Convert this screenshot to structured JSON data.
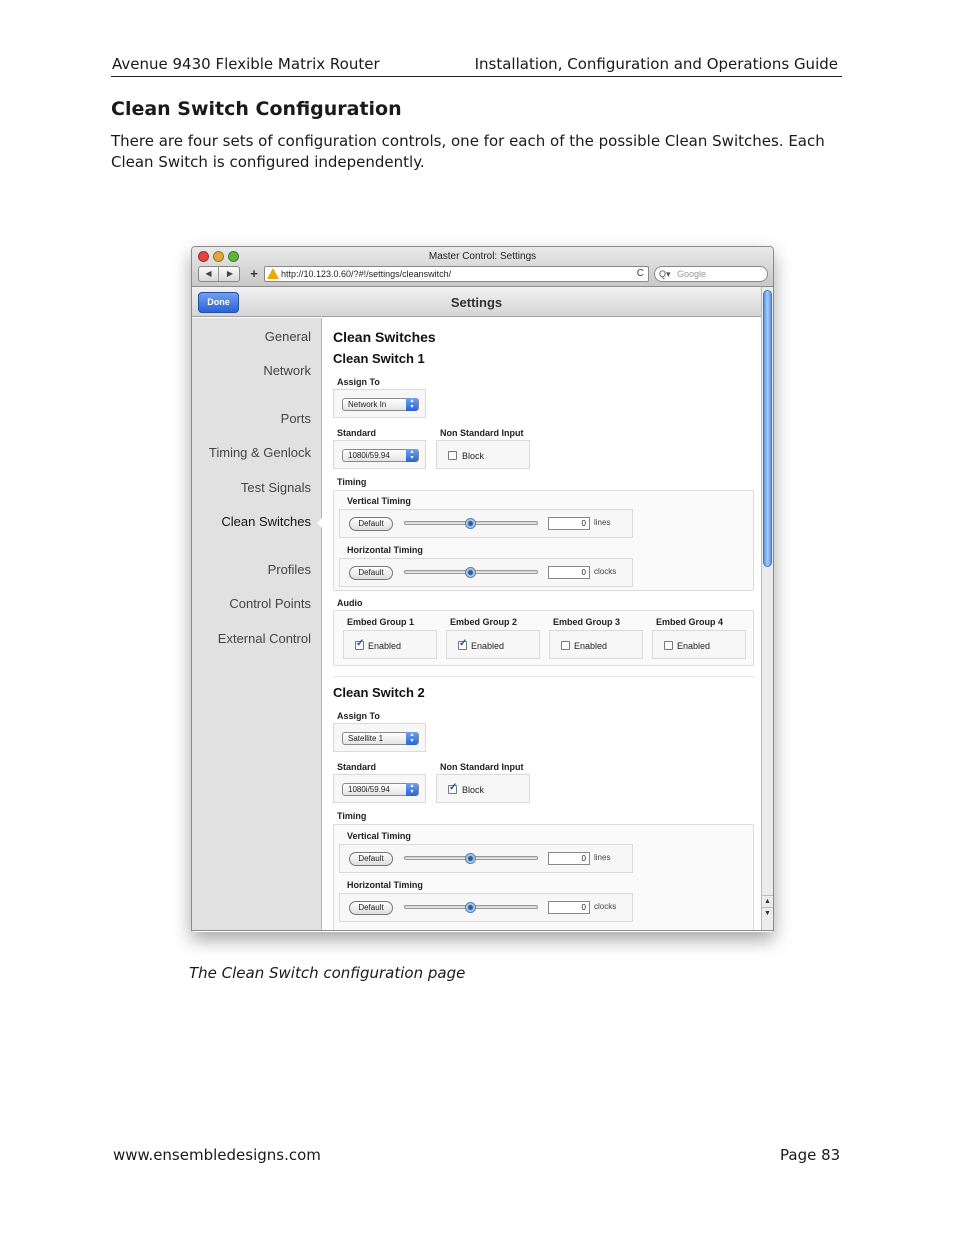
{
  "header": {
    "product": "Avenue 9430 Flexible Matrix Router",
    "guide": "Installation, Configuration and Operations Guide"
  },
  "section": {
    "title": "Clean Switch Configuration",
    "intro": "There are four sets of configuration controls, one for each of the possible Clean Switches. Each Clean Switch is configured independently."
  },
  "window": {
    "title": "Master Control: Settings",
    "url": "http://10.123.0.60/?#!/settings/cleanswitch/",
    "search_placeholder": "Google",
    "toolbar_title": "Settings",
    "done_label": "Done",
    "nav_back": "◀",
    "nav_forward": "▶",
    "plus": "+",
    "reload": "C",
    "search_glyph": "Q▾",
    "scroll_up": "▲",
    "scroll_down": "▼"
  },
  "sidebar": {
    "items": [
      {
        "label": "General"
      },
      {
        "label": "Network"
      },
      {
        "label": "Ports"
      },
      {
        "label": "Timing & Genlock"
      },
      {
        "label": "Test Signals"
      },
      {
        "label": "Clean Switches",
        "active": true
      },
      {
        "label": "Profiles"
      },
      {
        "label": "Control Points"
      },
      {
        "label": "External Control"
      }
    ]
  },
  "content": {
    "heading": "Clean Switches",
    "labels": {
      "assign_to": "Assign To",
      "standard": "Standard",
      "non_standard_input": "Non Standard Input",
      "block": "Block",
      "timing": "Timing",
      "vertical_timing": "Vertical Timing",
      "horizontal_timing": "Horizontal Timing",
      "default": "Default",
      "lines": "lines",
      "clocks": "clocks",
      "audio": "Audio",
      "enabled": "Enabled"
    },
    "switches": [
      {
        "title": "Clean Switch 1",
        "assign_to": "Network In",
        "standard": "1080i/59.94",
        "block": false,
        "vertical_value": "0",
        "horizontal_value": "0",
        "slider_position": 0.5,
        "embed_groups": [
          {
            "label": "Embed Group 1",
            "enabled": true
          },
          {
            "label": "Embed Group 2",
            "enabled": true
          },
          {
            "label": "Embed Group 3",
            "enabled": false
          },
          {
            "label": "Embed Group 4",
            "enabled": false
          }
        ]
      },
      {
        "title": "Clean Switch 2",
        "assign_to": "Satellite 1",
        "standard": "1080i/59.94",
        "block": true,
        "vertical_value": "0",
        "horizontal_value": "0",
        "slider_position": 0.5
      }
    ]
  },
  "caption": "The Clean Switch configuration page",
  "footer": {
    "website": "www.ensembledesigns.com",
    "page": "Page 83"
  }
}
